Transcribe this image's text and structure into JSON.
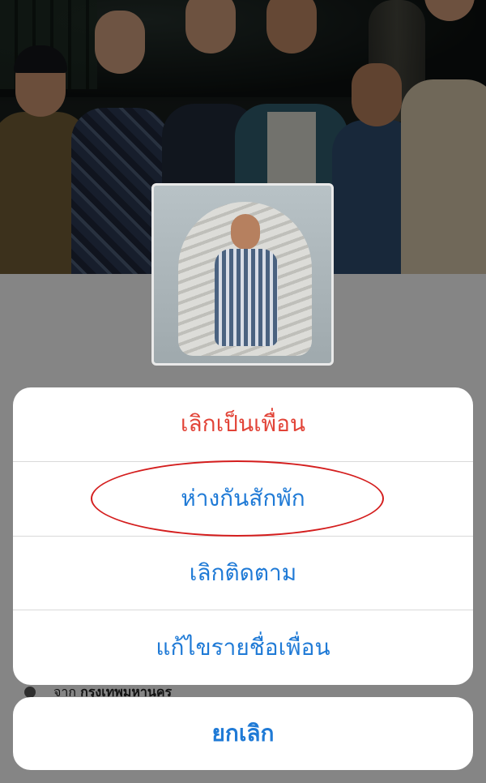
{
  "profile": {
    "location_prefix": "จาก",
    "location_value": "กรุงเทพมหานคร"
  },
  "action_sheet": {
    "items": [
      {
        "label": "เลิกเป็นเพื่อน",
        "style": "destructive",
        "color": "#e24438"
      },
      {
        "label": "ห่างกันสักพัก",
        "style": "default",
        "color": "#1f7ad6",
        "highlighted": true
      },
      {
        "label": "เลิกติดตาม",
        "style": "default",
        "color": "#1f7ad6"
      },
      {
        "label": "แก้ไขรายชื่อเพื่อน",
        "style": "default",
        "color": "#1f7ad6"
      }
    ],
    "cancel_label": "ยกเลิก"
  },
  "icons": {
    "location": "location-pin-icon"
  },
  "colors": {
    "accent": "#1f7ad6",
    "destructive": "#e24438",
    "highlight_annotation": "#d41e1e"
  }
}
